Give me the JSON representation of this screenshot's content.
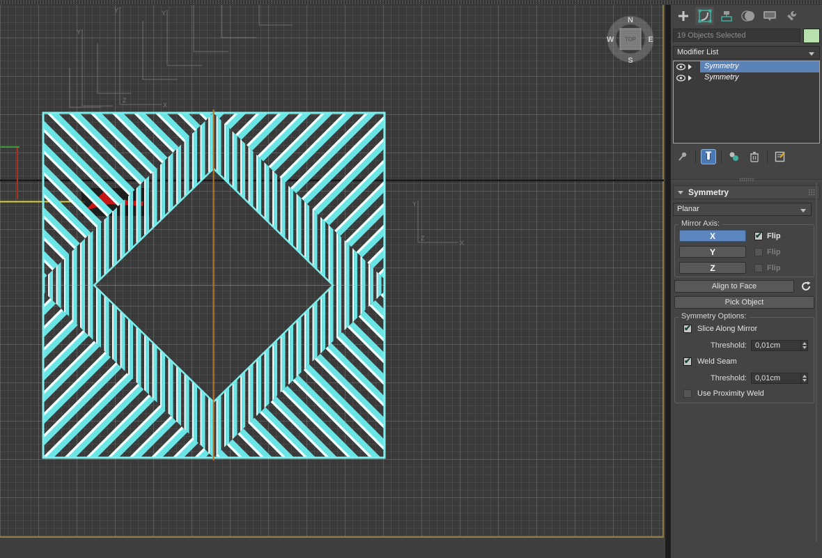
{
  "viewport": {
    "viewcube": {
      "n": "N",
      "w": "W",
      "s": "S",
      "e": "E",
      "face": "TOP"
    },
    "tripod_labels": {
      "x": "X",
      "y": "Y",
      "z": "Z"
    },
    "colors": {
      "wireframe_cyan": "#6ae4e4",
      "wireframe_white": "#f2fdfd",
      "mirror_plane_line": "#b5762e",
      "selection_bracket_yellow": "#d9d33a",
      "gizmo_red": "#c41414",
      "gizmo_green": "#3f9a3f",
      "viewport_border_tan": "#8d7b42"
    }
  },
  "panel": {
    "icons": {
      "create": "plus-icon",
      "modify": "modify-bezier-icon",
      "hierarchy": "hierarchy-icon",
      "motion": "motion-circles-icon",
      "display": "monitor-icon",
      "utilities": "wrench-icon",
      "pin": "pin-stack-icon",
      "show_end_result": "test-tube-icon",
      "make_unique": "make-unique-icon",
      "remove_modifier": "trash-icon",
      "configure_sets": "configure-modifier-sets-icon",
      "check_glyph": "✔"
    },
    "selection_status": "19 Objects Selected",
    "modifier_list_label": "Modifier List",
    "stack": {
      "rows": [
        {
          "label": "Symmetry",
          "selected": true
        },
        {
          "label": "Symmetry",
          "selected": false
        }
      ]
    },
    "rollout": {
      "title": "Symmetry",
      "mirror_type": "Planar",
      "mirror_axis_label": "Mirror Axis:",
      "axis_x": {
        "label": "X",
        "flip_label": "Flip",
        "flip_checked": true
      },
      "axis_y": {
        "label": "Y",
        "flip_label": "Flip",
        "flip_checked": false
      },
      "axis_z": {
        "label": "Z",
        "flip_label": "Flip",
        "flip_checked": false
      },
      "align_to_face_label": "Align to Face",
      "pick_object_label": "Pick Object",
      "options_label": "Symmetry Options:",
      "slice_label": "Slice Along Mirror",
      "slice_checked": true,
      "threshold_label_1": "Threshold:",
      "threshold_value_1": "0,01cm",
      "weld_label": "Weld Seam",
      "weld_checked": true,
      "threshold_label_2": "Threshold:",
      "threshold_value_2": "0,01cm",
      "proximity_label": "Use Proximity Weld",
      "proximity_checked": false
    }
  }
}
